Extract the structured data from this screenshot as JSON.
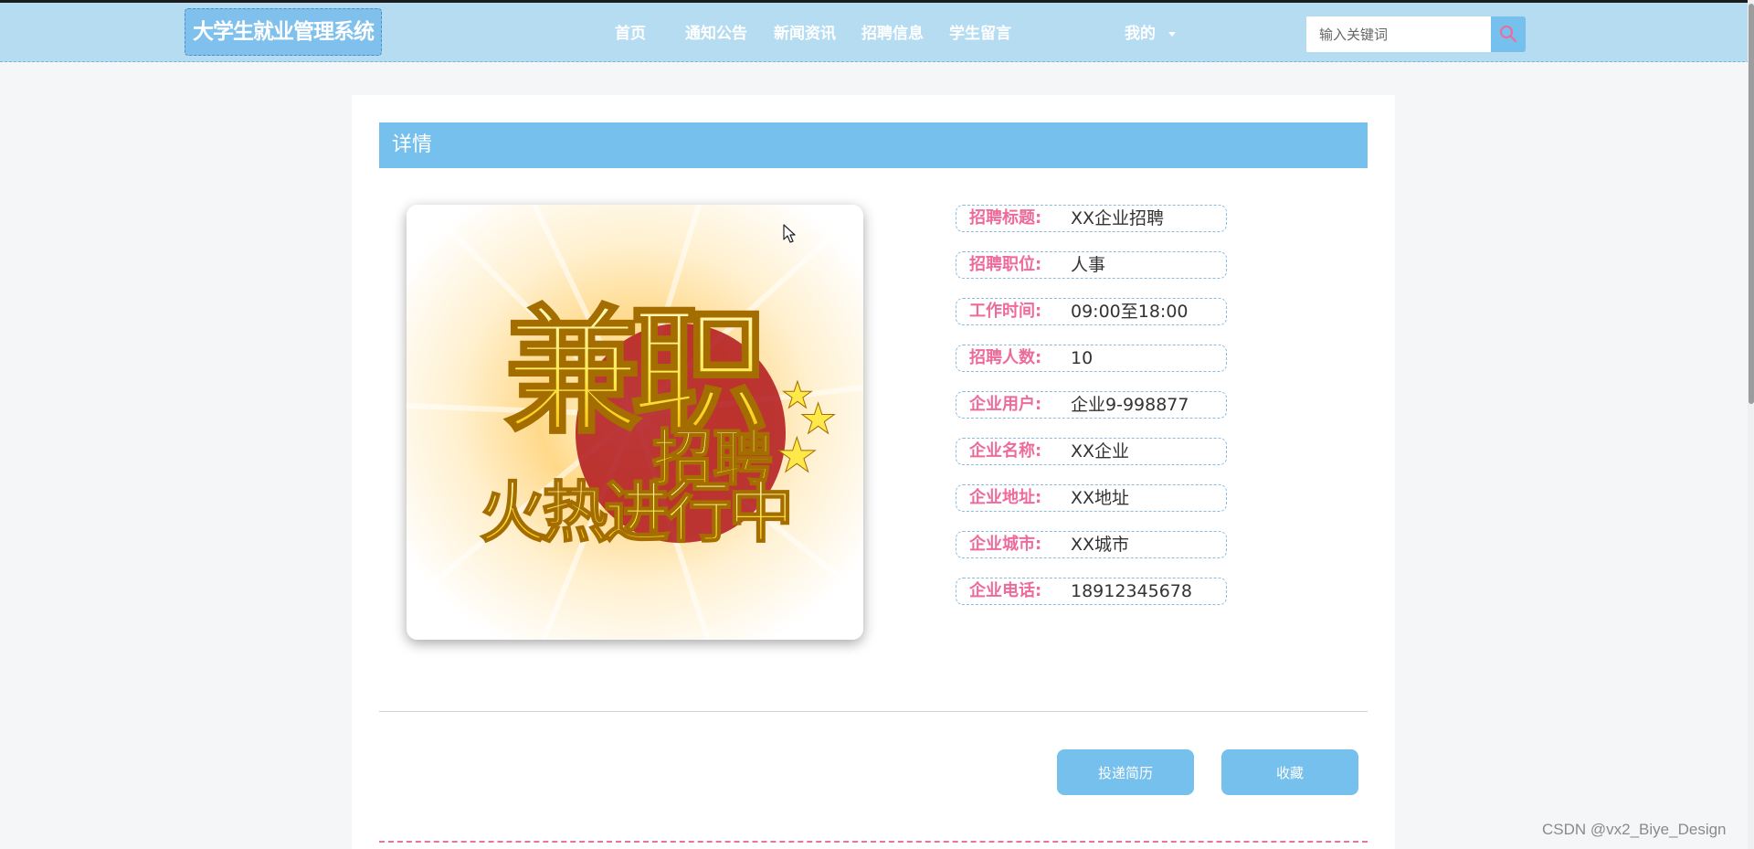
{
  "header": {
    "logo_text": "大学生就业管理系统",
    "nav": [
      {
        "label": "首页"
      },
      {
        "label": "通知公告"
      },
      {
        "label": "新闻资讯"
      },
      {
        "label": "招聘信息"
      },
      {
        "label": "学生留言"
      }
    ],
    "mine_label": "我的",
    "search": {
      "placeholder": "输入关键词",
      "icon": "search-icon"
    }
  },
  "detail": {
    "section_title": "详情",
    "poster": {
      "line1": "兼职",
      "line2": "招聘",
      "line3": "火热进行中",
      "star": "★"
    },
    "fields": [
      {
        "label": "招聘标题:",
        "value": "XX企业招聘"
      },
      {
        "label": "招聘职位:",
        "value": "人事"
      },
      {
        "label": "工作时间:",
        "value": "09:00至18:00"
      },
      {
        "label": "招聘人数:",
        "value": "10"
      },
      {
        "label": "企业用户:",
        "value": "企业9-998877"
      },
      {
        "label": "企业名称:",
        "value": "XX企业"
      },
      {
        "label": "企业地址:",
        "value": "XX地址"
      },
      {
        "label": "企业城市:",
        "value": "XX城市"
      },
      {
        "label": "企业电话:",
        "value": "18912345678"
      }
    ],
    "actions": {
      "apply_label": "投递简历",
      "favorite_label": "收藏"
    }
  },
  "watermark": "CSDN @vx2_Biye_Design",
  "colors": {
    "header_bg": "#b5dcf1",
    "accent": "#76c0ee",
    "label_pink": "#ec6b9b",
    "page_bg": "#f4f6f8"
  }
}
